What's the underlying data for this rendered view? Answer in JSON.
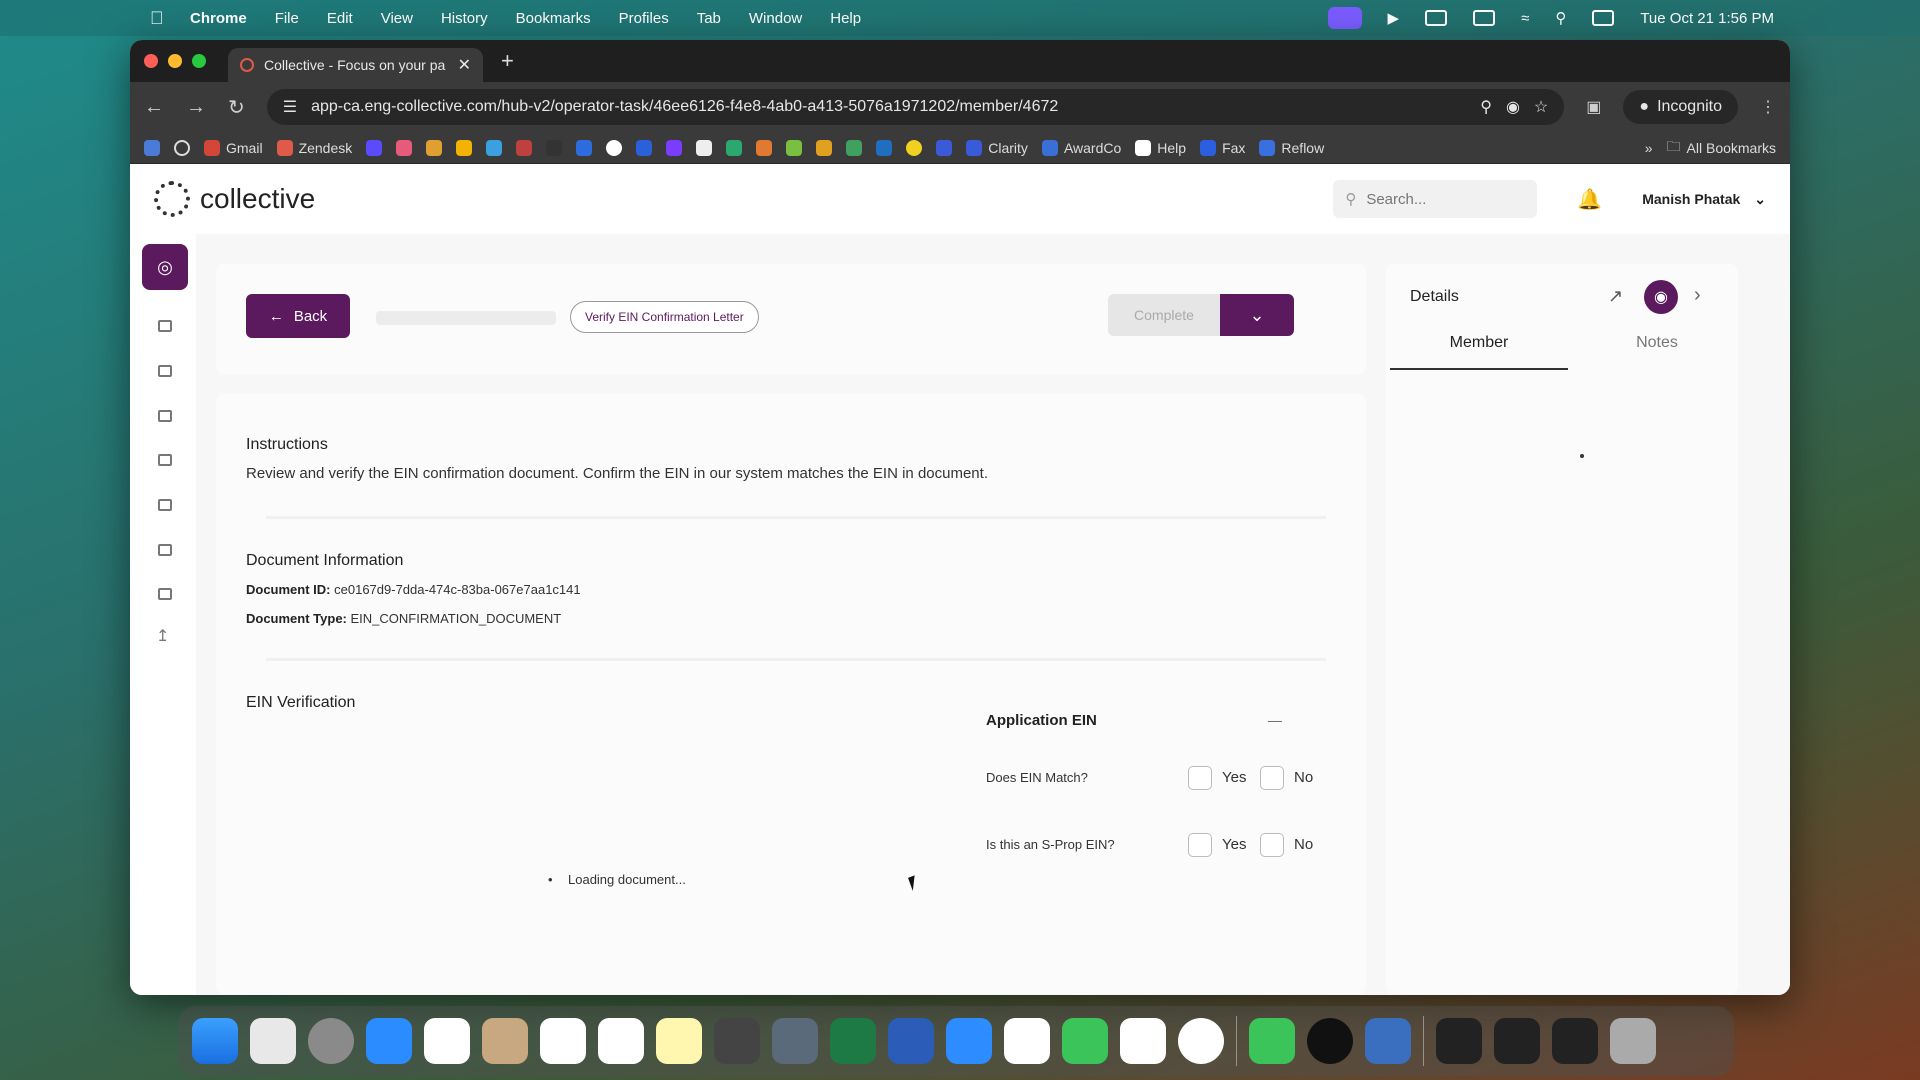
{
  "menubar": {
    "app": "Chrome",
    "menus": [
      "File",
      "Edit",
      "View",
      "History",
      "Bookmarks",
      "Profiles",
      "Tab",
      "Window",
      "Help"
    ],
    "datetime": "Tue Oct 21  1:56 PM"
  },
  "browser": {
    "tab_title": "Collective - Focus on your pa",
    "url": "app-ca.eng-collective.com/hub-v2/operator-task/46ee6126-f4e8-4ab0-a413-5076a1971202/member/4672",
    "incognito_label": "Incognito",
    "bookmarks": [
      {
        "label": "Gmail",
        "color": "#d44638"
      },
      {
        "label": "Zendesk",
        "color": "#e05a4a"
      },
      {
        "label": "Clarity",
        "color": "#3a5bd9"
      },
      {
        "label": "AwardCo",
        "color": "#3b6fd8"
      },
      {
        "label": "Help",
        "color": "#ffffff"
      },
      {
        "label": "Fax",
        "color": "#2c5fe0"
      },
      {
        "label": "Reflow",
        "color": "#3a6fe0"
      }
    ],
    "all_bookmarks": "All Bookmarks"
  },
  "header": {
    "brand": "collective",
    "search_placeholder": "Search...",
    "user_name": "Manish Phatak"
  },
  "task": {
    "back_label": "Back",
    "task_chip": "Verify EIN Confirmation Letter",
    "complete_label": "Complete"
  },
  "instructions": {
    "title": "Instructions",
    "text": "Review and verify the EIN confirmation document. Confirm the EIN in our system matches the EIN in document."
  },
  "document": {
    "title": "Document Information",
    "id_label": "Document ID:",
    "id_value": "ce0167d9-7dda-474c-83ba-067e7aa1c141",
    "type_label": "Document Type:",
    "type_value": "EIN_CONFIRMATION_DOCUMENT"
  },
  "verification": {
    "title": "EIN Verification",
    "application_ein_label": "Application EIN",
    "application_ein_value": "—",
    "q1": "Does EIN Match?",
    "q2": "Is this an S-Prop EIN?",
    "yes": "Yes",
    "no": "No",
    "loading": "Loading document..."
  },
  "details": {
    "title": "Details",
    "tabs": [
      "Member",
      "Notes"
    ],
    "active_tab": "Member"
  },
  "colors": {
    "brand_primary": "#5b1a5e"
  }
}
